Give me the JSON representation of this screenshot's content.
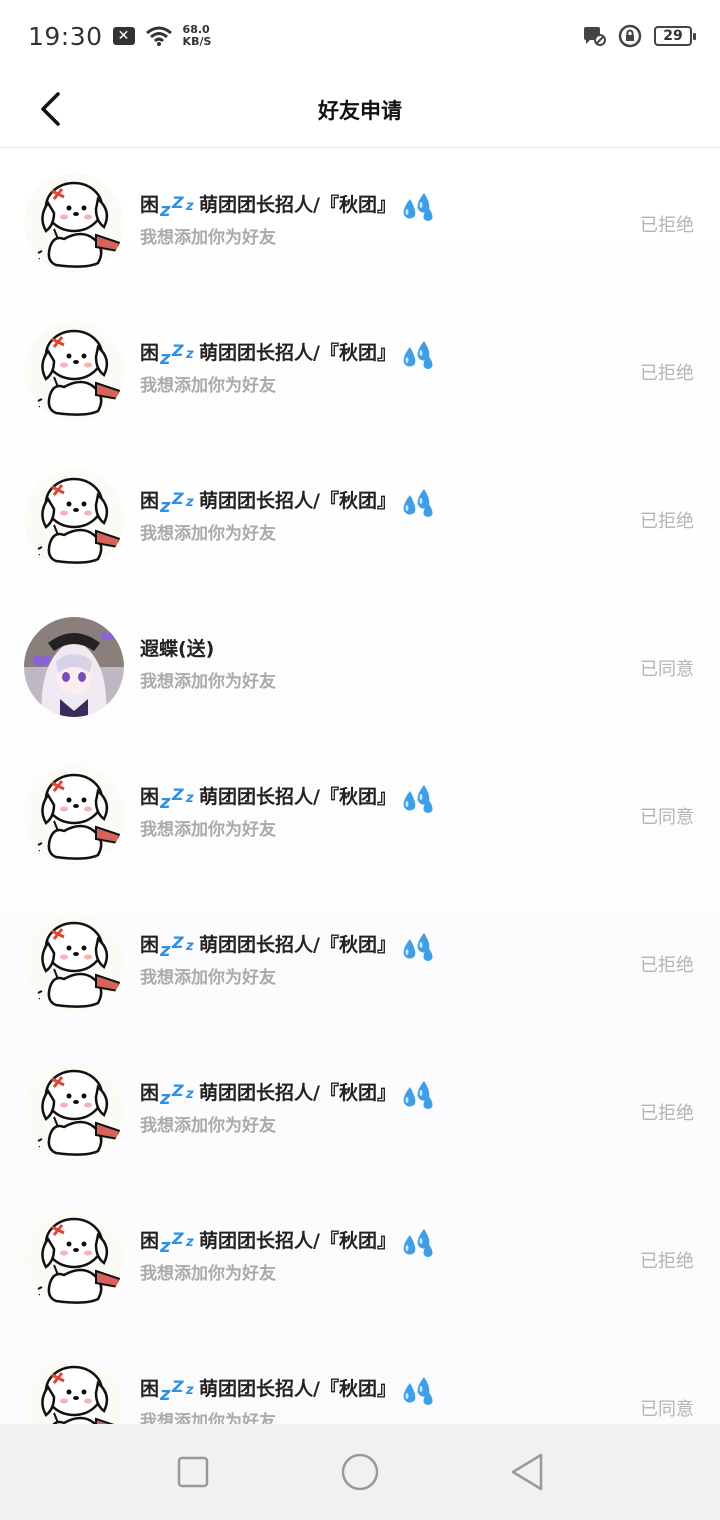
{
  "status_bar": {
    "time": "19:30",
    "speed_value": "68.0",
    "speed_unit": "KB/S",
    "battery": "29"
  },
  "header": {
    "title": "好友申请"
  },
  "requests": [
    {
      "name": "困💤萌团团长招人/『秋团』💦",
      "name_prefix": "困",
      "name_main": "萌团团长招人/『秋团』",
      "message": "我想添加你为好友",
      "status": "已拒绝",
      "avatar": "puppy"
    },
    {
      "name": "困💤萌团团长招人/『秋团』💦",
      "name_prefix": "困",
      "name_main": "萌团团长招人/『秋团』",
      "message": "我想添加你为好友",
      "status": "已拒绝",
      "avatar": "puppy"
    },
    {
      "name": "困💤萌团团长招人/『秋团』💦",
      "name_prefix": "困",
      "name_main": "萌团团长招人/『秋团』",
      "message": "我想添加你为好友",
      "status": "已拒绝",
      "avatar": "puppy"
    },
    {
      "name": "遐蝶(送)",
      "name_prefix": "",
      "name_main": "遐蝶(送)",
      "message": "我想添加你为好友",
      "status": "已同意",
      "avatar": "anime-girl"
    },
    {
      "name": "困💤萌团团长招人/『秋团』💦",
      "name_prefix": "困",
      "name_main": "萌团团长招人/『秋团』",
      "message": "我想添加你为好友",
      "status": "已同意",
      "avatar": "puppy"
    },
    {
      "name": "困💤萌团团长招人/『秋团』💦",
      "name_prefix": "困",
      "name_main": "萌团团长招人/『秋团』",
      "message": "我想添加你为好友",
      "status": "已拒绝",
      "avatar": "puppy"
    },
    {
      "name": "困💤萌团团长招人/『秋团』💦",
      "name_prefix": "困",
      "name_main": "萌团团长招人/『秋团』",
      "message": "我想添加你为好友",
      "status": "已拒绝",
      "avatar": "puppy"
    },
    {
      "name": "困💤萌团团长招人/『秋团』💦",
      "name_prefix": "困",
      "name_main": "萌团团长招人/『秋团』",
      "message": "我想添加你为好友",
      "status": "已拒绝",
      "avatar": "puppy"
    },
    {
      "name": "困💤萌团团长招人/『秋团』💦",
      "name_prefix": "困",
      "name_main": "萌团团长招人/『秋团』",
      "message": "我想添加你为好友",
      "status": "已同意",
      "avatar": "puppy"
    }
  ],
  "colors": {
    "status_text": "#b4b4b4",
    "emoji_blue": "#2f8fe0",
    "divider": "#e6e6e6"
  }
}
